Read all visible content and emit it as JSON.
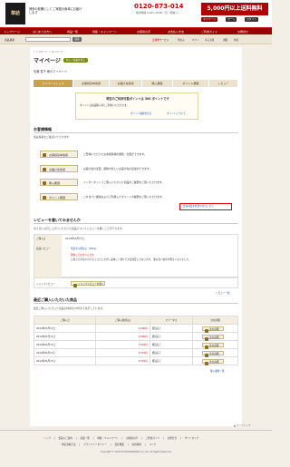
{
  "header": {
    "logo": "華結",
    "tagline": "博多の老舗として ご家庭の食卓にお届けします",
    "phone": "0120-873-014",
    "phone_hours": "受付時間 9:00〜18:00（日・祝除く）",
    "banner": "5,000円以上送料無料",
    "util": {
      "my": "マイページ",
      "cart": "カート",
      "login": "ログイン"
    }
  },
  "nav": {
    "items": [
      "トップページ",
      "はじめての方へ",
      "商品一覧",
      "特集・キャンペーン",
      "お客様の声",
      "お支払い方法",
      "ご利用ガイド",
      "お問合せ"
    ]
  },
  "search": {
    "label": "商品検索",
    "placeholder": "",
    "button": "検索"
  },
  "header_links": [
    "定期便サービス",
    "明太子",
    "ギフト",
    "辛子高菜",
    "通販",
    "博多"
  ],
  "page": {
    "breadcrumb": "トップページ ＞ マイページ",
    "title": "マイページ",
    "badge": "新しく商品を見る",
    "user": "長瀬 雪子 様のマイページ"
  },
  "tabs": [
    "マイページトップ",
    "お客様基本情報",
    "お届け先情報",
    "購入履歴",
    "ポイント履歴",
    "レビュー"
  ],
  "notice": {
    "title": "現在のご利用可能ポイントは 300 ポイントです",
    "text": "ポイントは商品購入時にご利用いただけます。",
    "links": [
      "ポイント履歴を見る",
      "ポイントについて"
    ]
  },
  "info": {
    "title": "お客様情報",
    "lead": "会員情報をご確認いただけます",
    "rows": [
      {
        "btn": "お客様基本情報",
        "desc": "ご登録いただいたお客様情報の閲覧・変更ができます。"
      },
      {
        "btn": "お届け先情報",
        "desc": "お届け先の変更、削除や新しいお届け先の追加ができます。"
      },
      {
        "btn": "購入履歴",
        "desc": "インターネットでご購入いただいた商品のご履歴をご覧いただけます。"
      },
      {
        "btn": "ポイント履歴",
        "desc": "これまでに獲得およびご利用したポイントの履歴をご覧いただけます。"
      }
    ],
    "withdraw": "会員退会を希望の方はこちら"
  },
  "review": {
    "title": "レビューを書いてみませんか",
    "lead": "皆さまにお召し上がりいただいた商品についてレビューを書くことができます。",
    "purchase_label": "ご購入日",
    "purchase_date": "2010年05月17日",
    "product_label": "商品レビュー",
    "product": "華結辛子明太子（300g）",
    "status": "現在しておまへんです",
    "body": "口当たりが良いのでもっさりとせずに美味しく頂けて大変満足しております。 量の多い食卓が明るくなりました。",
    "shop_label": "ショップレビュー",
    "shop_btn": "ショップレビューを書く",
    "more": "レビュー一覧"
  },
  "orders": {
    "title": "最近ご購入いただいた商品",
    "lead": "最近ご購入いただいた商品の情報を10件まで表示しています。",
    "headers": [
      "ご購入日",
      "ご購入額(税込)",
      "ステータス",
      "注文詳細"
    ],
    "rows": [
      {
        "date": "2010年05月17日",
        "amount": "1,000円",
        "status": "発送完了",
        "btn": "注文詳細"
      },
      {
        "date": "2010年05月17日",
        "amount": "3,600円",
        "status": "発送完了",
        "btn": "注文詳細"
      },
      {
        "date": "2010年05月17日",
        "amount": "1,570円",
        "status": "発送完了",
        "btn": "注文詳細"
      },
      {
        "date": "2010年05月17日",
        "amount": "1,570円",
        "status": "発送完了",
        "btn": "注文詳細"
      },
      {
        "date": "2010年05月17日",
        "amount": "1,570円",
        "status": "発送完了",
        "btn": "注文詳細"
      }
    ],
    "more": "購入履歴一覧"
  },
  "pagetop": "▲ ページトップ",
  "footer": {
    "links1": [
      "トップ",
      "会員のご案内",
      "商品一覧",
      "特集・キャンペーン",
      "お客様の声",
      "ご利用ガイド",
      "お問合せ",
      "サイトマップ"
    ],
    "links2": [
      "特定商取引法",
      "プライバシーポリシー",
      "会社概要",
      "採用情報",
      "リンク"
    ],
    "copyright": "Copyright © 2010 FUTAGONAMIKIDS Co.,Ltd. All Rights Reserved."
  },
  "colors": {
    "brand_red": "#9a0000",
    "accent_gold": "#c9a24d"
  }
}
